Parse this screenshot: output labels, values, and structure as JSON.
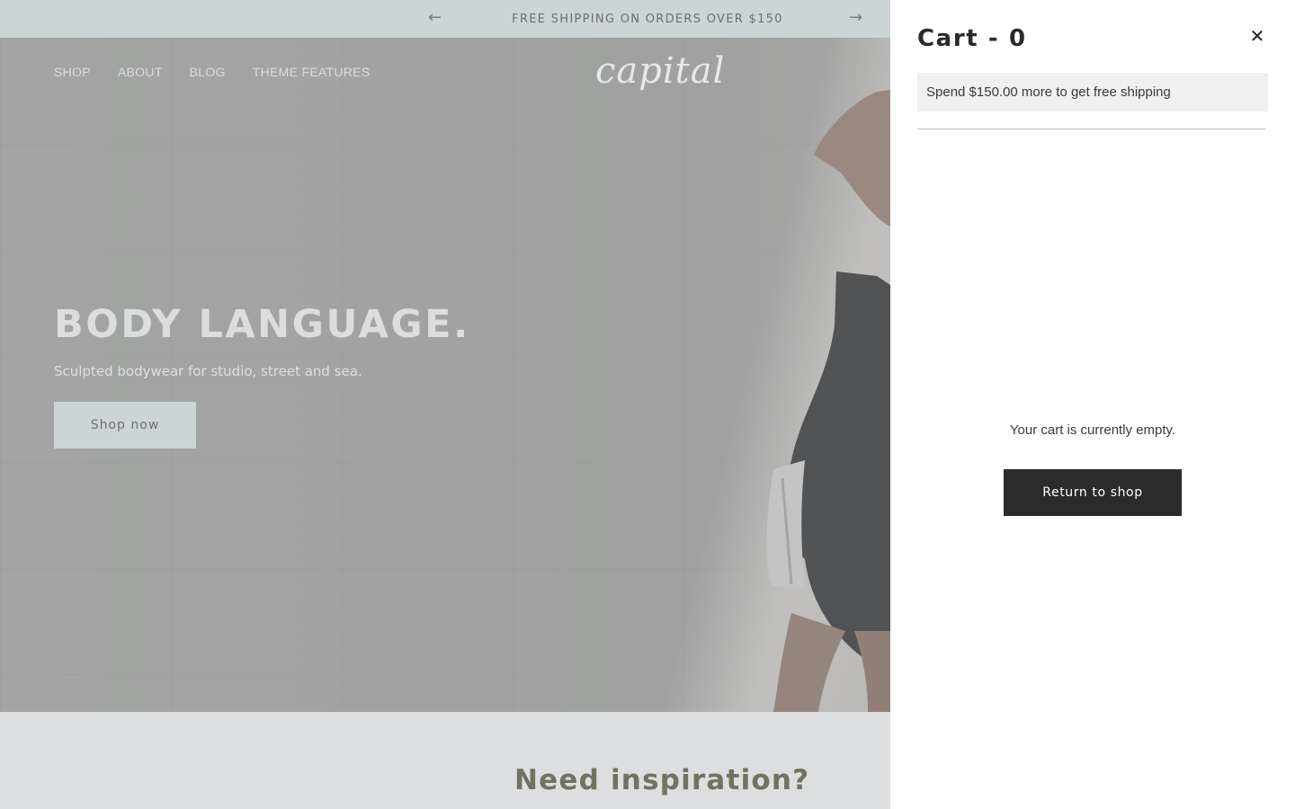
{
  "announcement": {
    "text": "FREE SHIPPING ON ORDERS OVER $150",
    "prev_icon": "arrow-left-icon",
    "next_icon": "arrow-right-icon"
  },
  "header": {
    "nav": [
      "SHOP",
      "ABOUT",
      "BLOG",
      "THEME FEATURES"
    ],
    "logo": "capital"
  },
  "hero": {
    "title": "BODY LANGUAGE.",
    "subtitle": "Sculpted bodywear for studio, street and sea.",
    "cta_label": "Shop now"
  },
  "section": {
    "title": "Need inspiration?"
  },
  "cart": {
    "title": "Cart - 0",
    "close_icon": "close-icon",
    "close_glyph": "✕",
    "shipping_message": "Spend $150.00 more to get free shipping",
    "empty_message": "Your cart is currently empty.",
    "return_label": "Return to shop"
  },
  "colors": {
    "announcement_bg": "#dfe8e8",
    "button_dark": "#2b2b2b",
    "shipping_bg": "#f0f0f0"
  }
}
